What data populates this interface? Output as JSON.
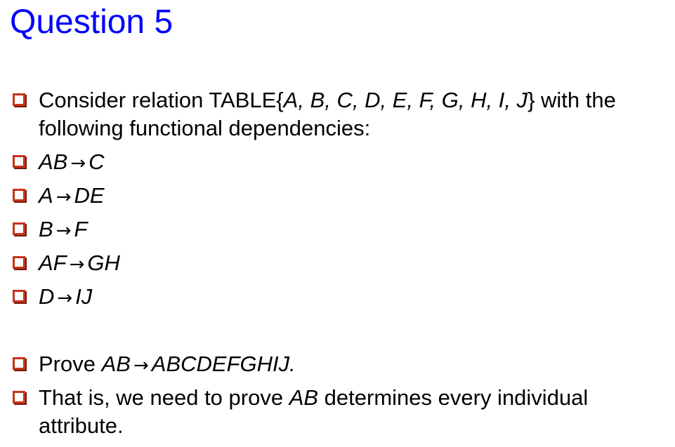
{
  "title": "Question 5",
  "relation": {
    "intro": "Consider relation TABLE{",
    "attributes": "A, B, C, D, E, F, G, H, I, J",
    "outro": "} with the following functional dependencies:"
  },
  "arrow_symbol": "→",
  "dependencies": [
    {
      "lhs": "AB",
      "rhs": "C"
    },
    {
      "lhs": "A",
      "rhs": "DE"
    },
    {
      "lhs": "B",
      "rhs": "F"
    },
    {
      "lhs": "AF",
      "rhs": "GH"
    },
    {
      "lhs": "D",
      "rhs": "IJ"
    }
  ],
  "prove": {
    "prefix": "Prove ",
    "lhs": "AB",
    "rhs": "ABCDEFGHIJ."
  },
  "that_is": {
    "prefix": "That is, we need to prove ",
    "subject": "AB",
    "suffix": " determines every individual attribute."
  },
  "colors": {
    "title": "#0000ff",
    "bullet": "#c8331a",
    "text": "#000000"
  }
}
